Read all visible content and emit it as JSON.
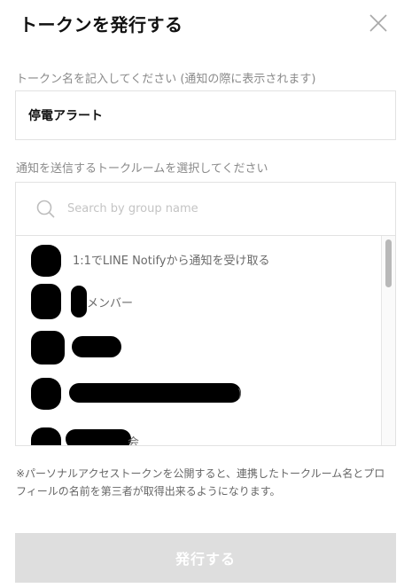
{
  "dialog": {
    "title": "トークンを発行する",
    "close_icon": "close-icon"
  },
  "token_name": {
    "label": "トークン名を記入してください (通知の際に表示されます)",
    "value": "停電アラート"
  },
  "room_select": {
    "label": "通知を送信するトークルームを選択してください",
    "search_placeholder": "Search by group name",
    "search_icon": "search-icon",
    "items": [
      {
        "text": "1:1でLINE Notifyから通知を受け取る"
      },
      {
        "text": "メンバー"
      },
      {
        "text": ""
      },
      {
        "text": ")"
      },
      {
        "text": "会"
      }
    ]
  },
  "notice": "※パーソナルアクセストークンを公開すると、連携したトークルーム名とプロフィールの名前を第三者が取得出来るようになります。",
  "submit_label": "発行する",
  "colors": {
    "submit_disabled_bg": "#dedede",
    "border": "#e2e2e2",
    "label": "#8a8a8a"
  }
}
